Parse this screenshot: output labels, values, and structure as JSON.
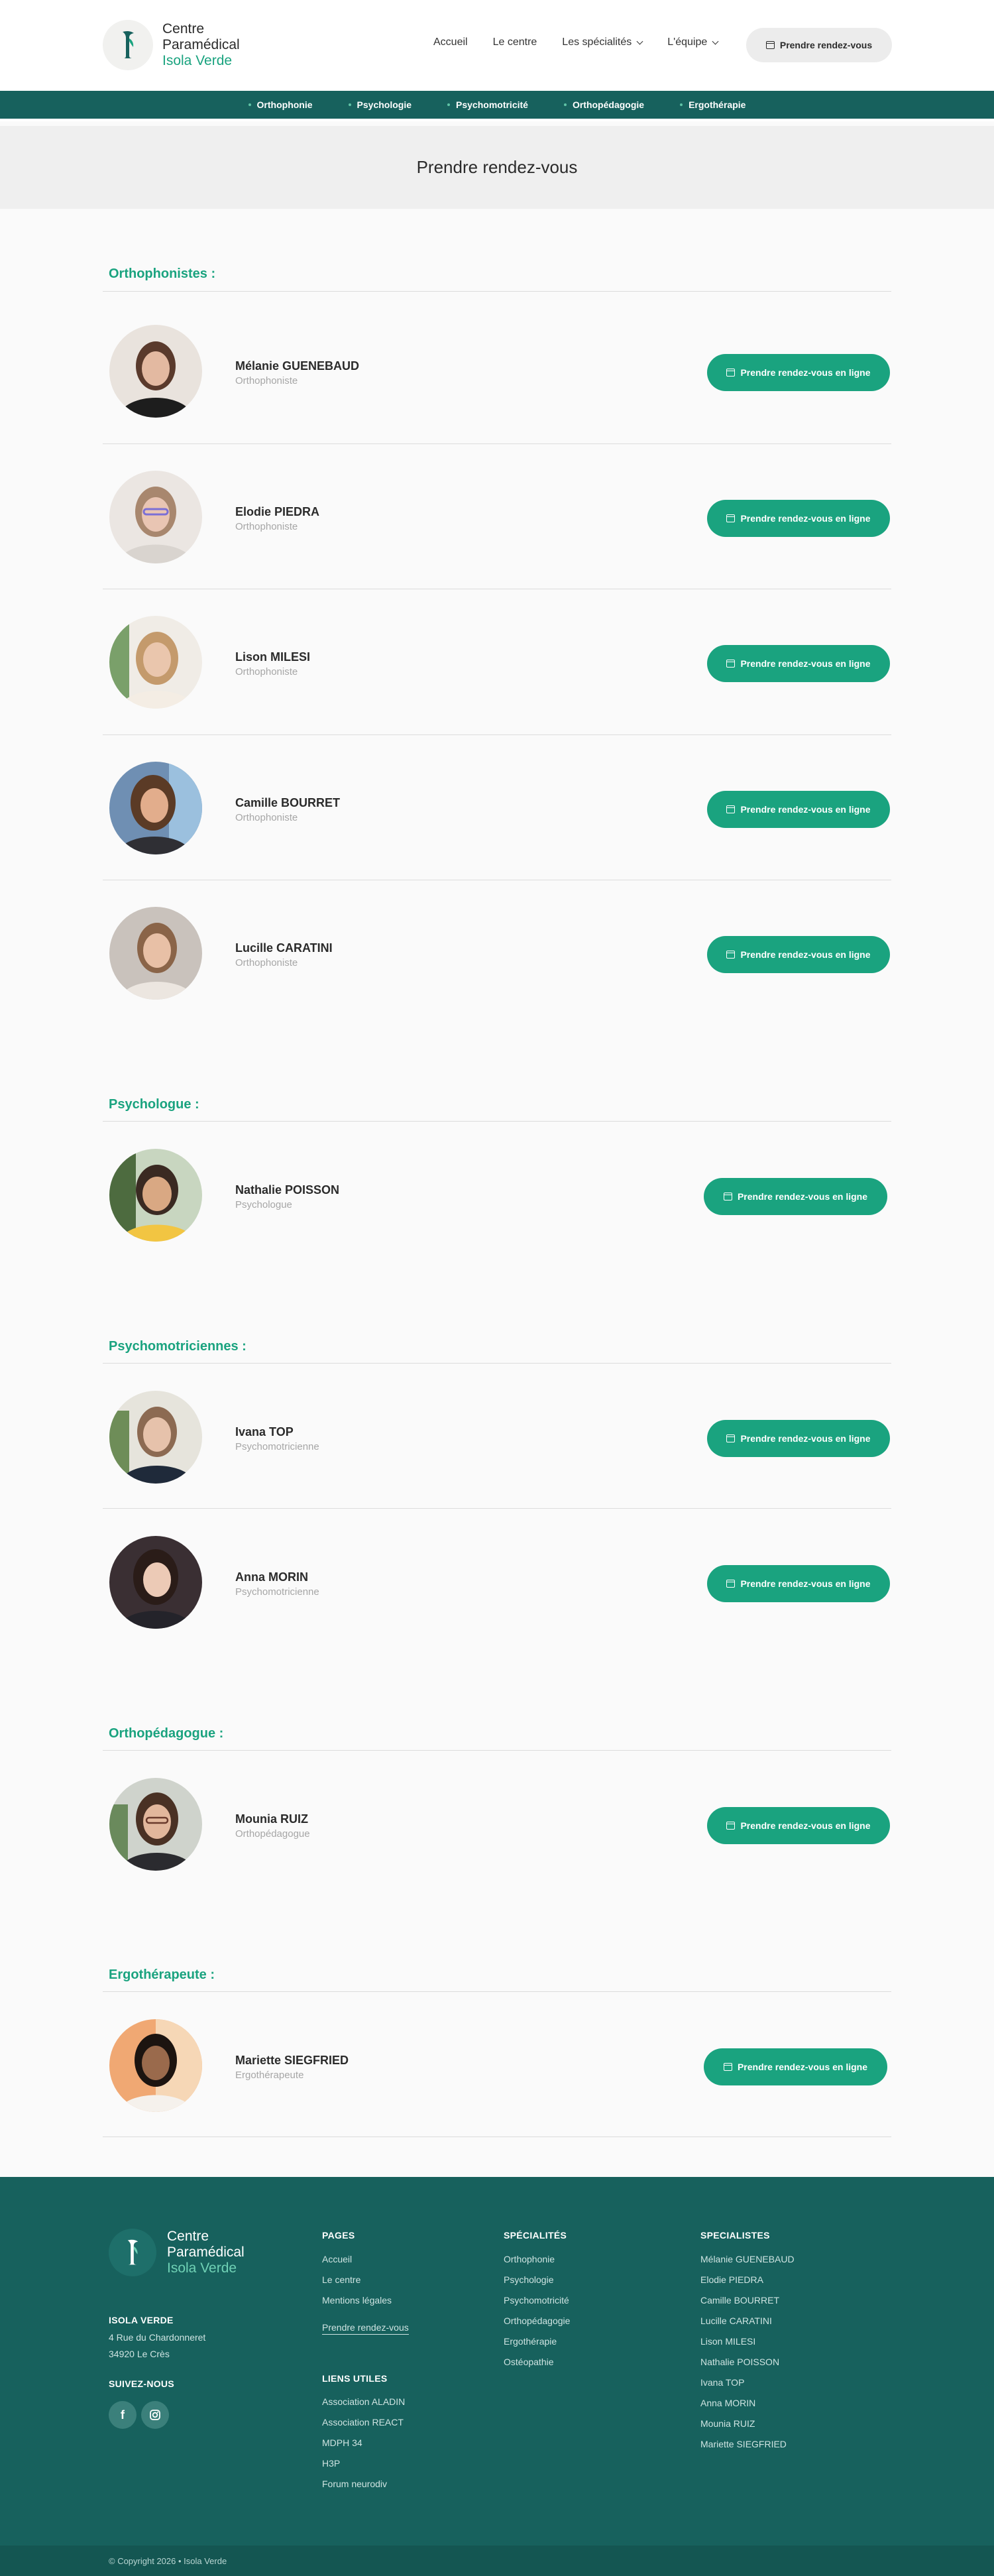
{
  "header": {
    "logo": {
      "line1": "Centre",
      "line2": "Paramédical",
      "line3": "Isola Verde"
    },
    "nav": [
      {
        "label": "Accueil",
        "dropdown": false
      },
      {
        "label": "Le centre",
        "dropdown": false
      },
      {
        "label": "Les spécialités",
        "dropdown": true
      },
      {
        "label": "L'équipe",
        "dropdown": true
      }
    ],
    "cta_label": "Prendre rendez-vous"
  },
  "specialties_bar": [
    "Orthophonie",
    "Psychologie",
    "Psychomotricité",
    "Orthopédagogie",
    "Ergothérapie"
  ],
  "page_title": "Prendre rendez-vous",
  "sections": [
    {
      "title": "Orthophonistes :",
      "people": [
        {
          "name": "Mélanie GUENEBAUD",
          "role": "Orthophoniste",
          "button": "Prendre rendez-vous en ligne"
        },
        {
          "name": "Elodie PIEDRA",
          "role": "Orthophoniste",
          "button": "Prendre rendez-vous en ligne"
        },
        {
          "name": "Lison MILESI",
          "role": "Orthophoniste",
          "button": "Prendre rendez-vous en ligne"
        },
        {
          "name": "Camille BOURRET",
          "role": "Orthophoniste",
          "button": "Prendre rendez-vous en ligne"
        },
        {
          "name": "Lucille CARATINI",
          "role": "Orthophoniste",
          "button": "Prendre rendez-vous en ligne"
        }
      ]
    },
    {
      "title": "Psychologue :",
      "people": [
        {
          "name": "Nathalie POISSON",
          "role": "Psychologue",
          "button": "Prendre rendez-vous en ligne"
        }
      ]
    },
    {
      "title": "Psychomotriciennes :",
      "people": [
        {
          "name": "Ivana TOP",
          "role": "Psychomotricienne",
          "button": "Prendre rendez-vous en ligne"
        },
        {
          "name": "Anna MORIN",
          "role": "Psychomotricienne",
          "button": "Prendre rendez-vous en ligne"
        }
      ]
    },
    {
      "title": "Orthopédagogue :",
      "people": [
        {
          "name": "Mounia RUIZ",
          "role": "Orthopédagogue",
          "button": "Prendre rendez-vous en ligne"
        }
      ]
    },
    {
      "title": "Ergothérapeute :",
      "people": [
        {
          "name": "Mariette SIEGFRIED",
          "role": "Ergothérapeute",
          "button": "Prendre rendez-vous en ligne"
        }
      ]
    }
  ],
  "footer": {
    "logo": {
      "line1": "Centre",
      "line2": "Paramédical",
      "line3": "Isola Verde"
    },
    "address_title": "ISOLA VERDE",
    "address_line1": "4 Rue du Chardonneret",
    "address_line2": "34920 Le Crès",
    "follow_title": "SUIVEZ-NOUS",
    "social": [
      "facebook-icon",
      "instagram-icon"
    ],
    "pages_title": "PAGES",
    "pages": [
      "Accueil",
      "Le centre",
      "Mentions légales",
      "Prendre rendez-vous"
    ],
    "links_title": "LIENS UTILES",
    "links": [
      "Association ALADIN",
      "Association REACT",
      "MDPH 34",
      "H3P",
      "Forum neurodiv"
    ],
    "specialites_title": "SPÉCIALITÉS",
    "specialites": [
      "Orthophonie",
      "Psychologie",
      "Psychomotricité",
      "Orthopédagogie",
      "Ergothérapie",
      "Ostéopathie"
    ],
    "specialistes_title": "SPECIALISTES",
    "specialistes": [
      "Mélanie GUENEBAUD",
      "Elodie PIEDRA",
      "Camille BOURRET",
      "Lucille CARATINI",
      "Lison MILESI",
      "Nathalie POISSON",
      "Ivana TOP",
      "Anna MORIN",
      "Mounia RUIZ",
      "Mariette SIEGFRIED"
    ],
    "copyright": "© Copyright 2026 • Isola Verde"
  },
  "colors": {
    "accent": "#1aa37f",
    "dark_teal": "#17615d",
    "banner": "#efefef"
  }
}
